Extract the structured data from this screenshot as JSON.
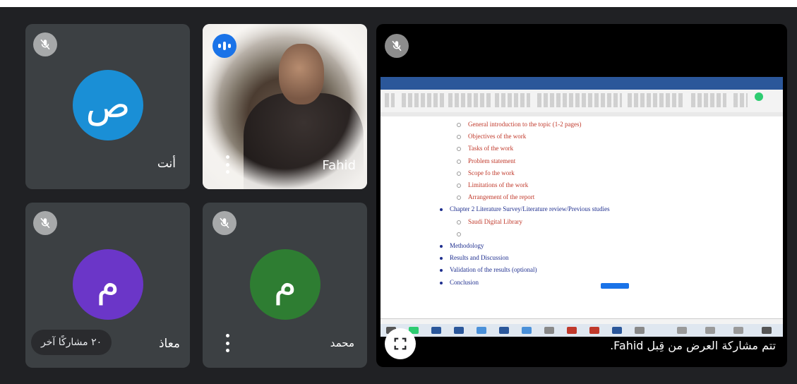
{
  "participants": {
    "self": {
      "initial": "ص",
      "name": "أنت",
      "color": "#1a8fd6",
      "muted": true
    },
    "fahid": {
      "name": "Fahid",
      "speaking": true
    },
    "muadh": {
      "initial": "م",
      "name": "معاذ",
      "color": "#6b36c8",
      "muted": true
    },
    "mohammed": {
      "initial": "م",
      "name": "محمد",
      "color": "#2e7d32",
      "muted": true
    },
    "others_pill": "٢٠ مشاركًا آخر"
  },
  "presentation": {
    "caption": "تتم مشاركة العرض من قِبل Fahid.",
    "muted": true,
    "document_lines": [
      {
        "kind": "sub",
        "text": "General introduction to the topic (1-2 pages)"
      },
      {
        "kind": "sub",
        "text": "Objectives of the work"
      },
      {
        "kind": "sub",
        "text": "Tasks of the work"
      },
      {
        "kind": "sub",
        "text": "Problem statement"
      },
      {
        "kind": "sub",
        "text": "Scope fo the work"
      },
      {
        "kind": "sub",
        "text": "Limitations of the work"
      },
      {
        "kind": "sub",
        "text": "Arrangement of the report"
      },
      {
        "kind": "main",
        "text": "Chapter 2 Literature Survey/Literature review/Previous studies"
      },
      {
        "kind": "sub",
        "text": "Saudi Digital Library"
      },
      {
        "kind": "sub",
        "text": ""
      },
      {
        "kind": "main",
        "text": "Methodology"
      },
      {
        "kind": "main",
        "text": "Results and Discussion"
      },
      {
        "kind": "main",
        "text": "Validation of the results (optional)"
      },
      {
        "kind": "main",
        "text": "Conclusion"
      }
    ]
  },
  "colors": {
    "tile_bg": "#3c4043",
    "page_bg": "#202124",
    "speaking_blue": "#1a73e8"
  }
}
